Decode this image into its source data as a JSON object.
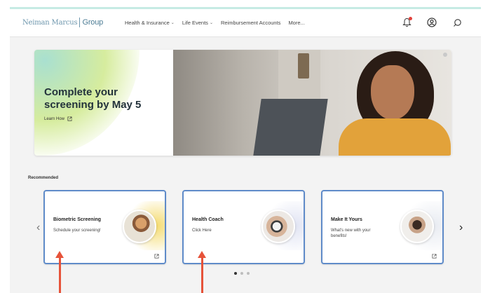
{
  "header": {
    "logo_brand": "Neiman Marcus",
    "logo_group": "Group",
    "nav": [
      {
        "label": "Health & Insurance",
        "has_dropdown": true
      },
      {
        "label": "Life Events",
        "has_dropdown": true
      },
      {
        "label": "Reimbursement Accounts",
        "has_dropdown": false
      },
      {
        "label": "More...",
        "has_dropdown": false
      }
    ],
    "icons": [
      "bell-icon",
      "user-icon",
      "search-icon"
    ],
    "notification_color": "#e2413b"
  },
  "hero": {
    "title": "Complete your screening by May 5",
    "link_label": "Learn How"
  },
  "recommended": {
    "label": "Recommended",
    "cards": [
      {
        "title": "Biometric Screening",
        "subtitle": "Schedule your screening!",
        "accent": "#f2d24a"
      },
      {
        "title": "Health Coach",
        "subtitle": "Click Here",
        "accent": "#d9ddf0"
      },
      {
        "title": "Make It Yours",
        "subtitle": "What's new with your benefits!",
        "accent": "#e2e6ee"
      }
    ],
    "prev_glyph": "‹",
    "next_glyph": "›"
  },
  "colors": {
    "card_border": "#5f8bc9",
    "annotation_arrow": "#e6533a",
    "accent_teal": "#c6ebe4"
  }
}
